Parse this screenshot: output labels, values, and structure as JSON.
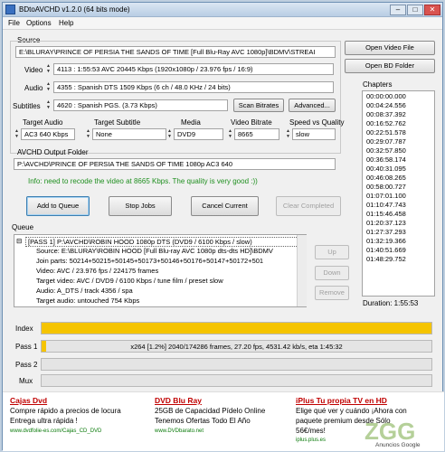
{
  "window": {
    "title": "BDtoAVCHD v1.2.0    (64 bits mode)"
  },
  "menu": [
    "File",
    "Options",
    "Help"
  ],
  "source": {
    "group_label": "Source",
    "path": "E:\\BLURAY\\PRINCE OF PERSIA THE SANDS OF TIME [Full Blu-Ray AVC 1080p]\\BDMV\\STREAI",
    "open_video_label": "Open Video File",
    "open_bd_label": "Open BD Folder"
  },
  "streams": {
    "video_label": "Video",
    "video_value": "4113 : 1:55:53  AVC  20445 Kbps  (1920x1080p / 23.976 fps / 16:9)",
    "audio_label": "Audio",
    "audio_value": "4355 : Spanish  DTS  1509 Kbps  (6 ch / 48.0 KHz / 24 bits)",
    "subtitles_label": "Subtitles",
    "subtitles_value": "4620 : Spanish  PGS.  (3.73 Kbps)",
    "scan_bitrates_label": "Scan Bitrates",
    "advanced_label": "Advanced..."
  },
  "settings": {
    "target_audio_label": "Target Audio",
    "target_audio_value": "AC3 640 Kbps",
    "target_subtitle_label": "Target Subtitle",
    "target_subtitle_value": "None",
    "media_label": "Media",
    "media_value": "DVD9",
    "video_bitrate_label": "Video Bitrate",
    "video_bitrate_value": "8665",
    "speed_label": "Speed vs Quality",
    "speed_value": "slow"
  },
  "output": {
    "label": "AVCHD Output Folder",
    "path": "P:\\AVCHD\\PRINCE OF PERSIA THE SANDS OF TIME 1080p AC3 640",
    "info": "Info: need to recode the video at 8665 Kbps. The quality is very good :))"
  },
  "actions": {
    "add_to_queue": "Add to Queue",
    "stop_jobs": "Stop Jobs",
    "cancel_current": "Cancel Current",
    "clear_completed": "Clear Completed"
  },
  "queue": {
    "label": "Queue",
    "header": "[PASS 1]          P:\\AVCHD\\ROBIN HOOD 1080p DTS (DVD9 / 6100 Kbps / slow)",
    "lines": [
      "Source: E:\\BLURAY\\ROBIN HOOD [Full Blu-ray AVC 1080p dts-dts HD]\\BDMV",
      "Join parts: 50214+50215+50145+50173+50146+50176+50147+50172+501",
      "Video: AVC / 23.976 fps / 224175 frames",
      "Target video: AVC / DVD9 / 6100 Kbps / tune film / preset slow",
      "Audio: A_DTS / track 4356 / spa",
      "Target audio: untouched 754 Kbps"
    ],
    "up_label": "Up",
    "down_label": "Down",
    "remove_label": "Remove"
  },
  "chapters": {
    "label": "Chapters",
    "items": [
      "00:00:00.000",
      "00:04:24.556",
      "00:08:37.392",
      "00:16:52.762",
      "00:22:51.578",
      "00:29:07.787",
      "00:32:57.850",
      "00:36:58.174",
      "00:40:31.095",
      "00:46:08.265",
      "00:58:00.727",
      "01:07:01.100",
      "01:10:47.743",
      "01:15:46.458",
      "01:20:37.123",
      "01:27:37.293",
      "01:32:19.366",
      "01:40:51.669",
      "01:48:29.752"
    ],
    "duration_label": "Duration: 1:55:53"
  },
  "progress": {
    "index_label": "Index",
    "index_fraction": 1.0,
    "pass1_label": "Pass 1",
    "pass1_fraction": 0.012,
    "pass1_text": "x264 [1.2%] 2040/174286 frames, 27.20 fps, 4531.42 kb/s, eta 1:45:32",
    "pass2_label": "Pass 2",
    "pass2_fraction": 0,
    "mux_label": "Mux",
    "mux_fraction": 0
  },
  "ads": [
    {
      "title": "Cajas Dvd",
      "line1": "Compre rápido a precios de locura",
      "line2": "Entrega ultra rápida !",
      "url": "www.dvdfolie-es.com/Cajas_CD_DVD"
    },
    {
      "title": "DVD Blu Ray",
      "line1": "25GB de Capacidad Pídelo Online",
      "line2": "Tenemos Ofertas Todo El Año",
      "url": "www.DVDbarato.net"
    },
    {
      "title": "iPlus Tu propia TV en HD",
      "line1": "Elige qué ver y cuándo ¡Ahora con",
      "line2": "paquete premium desde Sólo",
      "line3": "56€/mes!",
      "url": "iplus.plus.es"
    }
  ],
  "ads_footer": "Anuncios Google",
  "watermark": "ZGG"
}
